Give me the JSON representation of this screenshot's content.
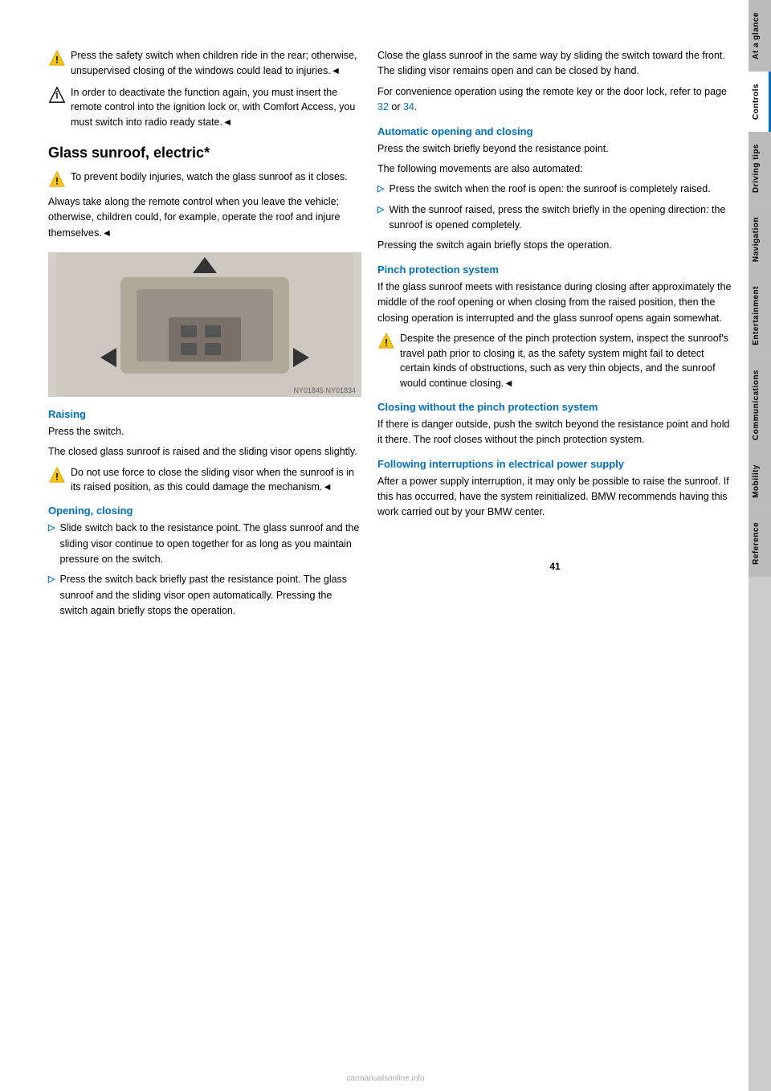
{
  "page": {
    "number": "41",
    "watermark": "carmanualsonline.info"
  },
  "sidebar": {
    "tabs": [
      {
        "label": "At a glance",
        "active": false
      },
      {
        "label": "Controls",
        "active": true
      },
      {
        "label": "Driving tips",
        "active": false
      },
      {
        "label": "Navigation",
        "active": false
      },
      {
        "label": "Entertainment",
        "active": false
      },
      {
        "label": "Communications",
        "active": false
      },
      {
        "label": "Mobility",
        "active": false
      },
      {
        "label": "Reference",
        "active": false
      }
    ]
  },
  "left_column": {
    "warning1": {
      "text": "Press the safety switch when children ride in the rear; otherwise, unsupervised closing of the windows could lead to injuries.◄"
    },
    "info1": {
      "text": "In order to deactivate the function again, you must insert the remote control into the ignition lock or, with Comfort Access, you must switch into radio ready state.◄"
    },
    "section_title": "Glass sunroof, electric*",
    "warning2": {
      "text": "To prevent bodily injuries, watch the glass sunroof as it closes."
    },
    "body1": "Always take along the remote control when you leave the vehicle; otherwise, children could, for example, operate the roof and injure themselves.◄",
    "raising_title": "Raising",
    "raising_body1": "Press the switch.",
    "raising_body2": "The closed glass sunroof is raised and the sliding visor opens slightly.",
    "warning3": {
      "text": "Do not use force to close the sliding visor when the sunroof is in its raised position, as this could damage the mechanism.◄"
    },
    "opening_closing_title": "Opening, closing",
    "bullet1": {
      "text": "Slide switch back to the resistance point. The glass sunroof and the sliding visor continue to open together for as long as you maintain pressure on the switch."
    },
    "bullet2": {
      "text": "Press the switch back briefly past the resistance point. The glass sunroof and the sliding visor open automatically. Pressing the switch again briefly stops the operation."
    }
  },
  "right_column": {
    "intro1": "Close the glass sunroof in the same way by sliding the switch toward the front. The sliding visor remains open and can be closed by hand.",
    "intro2": "For convenience operation using the remote key or the door lock, refer to page 32 or 34.",
    "page_ref1": "32",
    "page_ref2": "34",
    "automatic_title": "Automatic opening and closing",
    "automatic_body1": "Press the switch briefly beyond the resistance point.",
    "automatic_body2": "The following movements are also automated:",
    "auto_bullet1": "Press the switch when the roof is open: the sunroof is completely raised.",
    "auto_bullet2": "With the sunroof raised, press the switch briefly in the opening direction: the sunroof is opened completely.",
    "auto_body3": "Pressing the switch again briefly stops the operation.",
    "pinch_title": "Pinch protection system",
    "pinch_body1": "If the glass sunroof meets with resistance during closing after approximately the middle of the roof opening or when closing from the raised position, then the closing operation is interrupted and the glass sunroof opens again somewhat.",
    "pinch_warning": {
      "text": "Despite the presence of the pinch protection system, inspect the sunroof's travel path prior to closing it, as the safety system might fail to detect certain kinds of obstructions, such as very thin objects, and the sunroof would continue closing.◄"
    },
    "closing_no_pinch_title": "Closing without the pinch protection system",
    "closing_no_pinch_body": "If there is danger outside, push the switch beyond the resistance point and hold it there. The roof closes without the pinch protection system.",
    "following_title": "Following interruptions in electrical power supply",
    "following_body": "After a power supply interruption, it may only be possible to raise the sunroof. If this has occurred, have the system reinitialized. BMW recommends having this work carried out by your BMW center."
  }
}
